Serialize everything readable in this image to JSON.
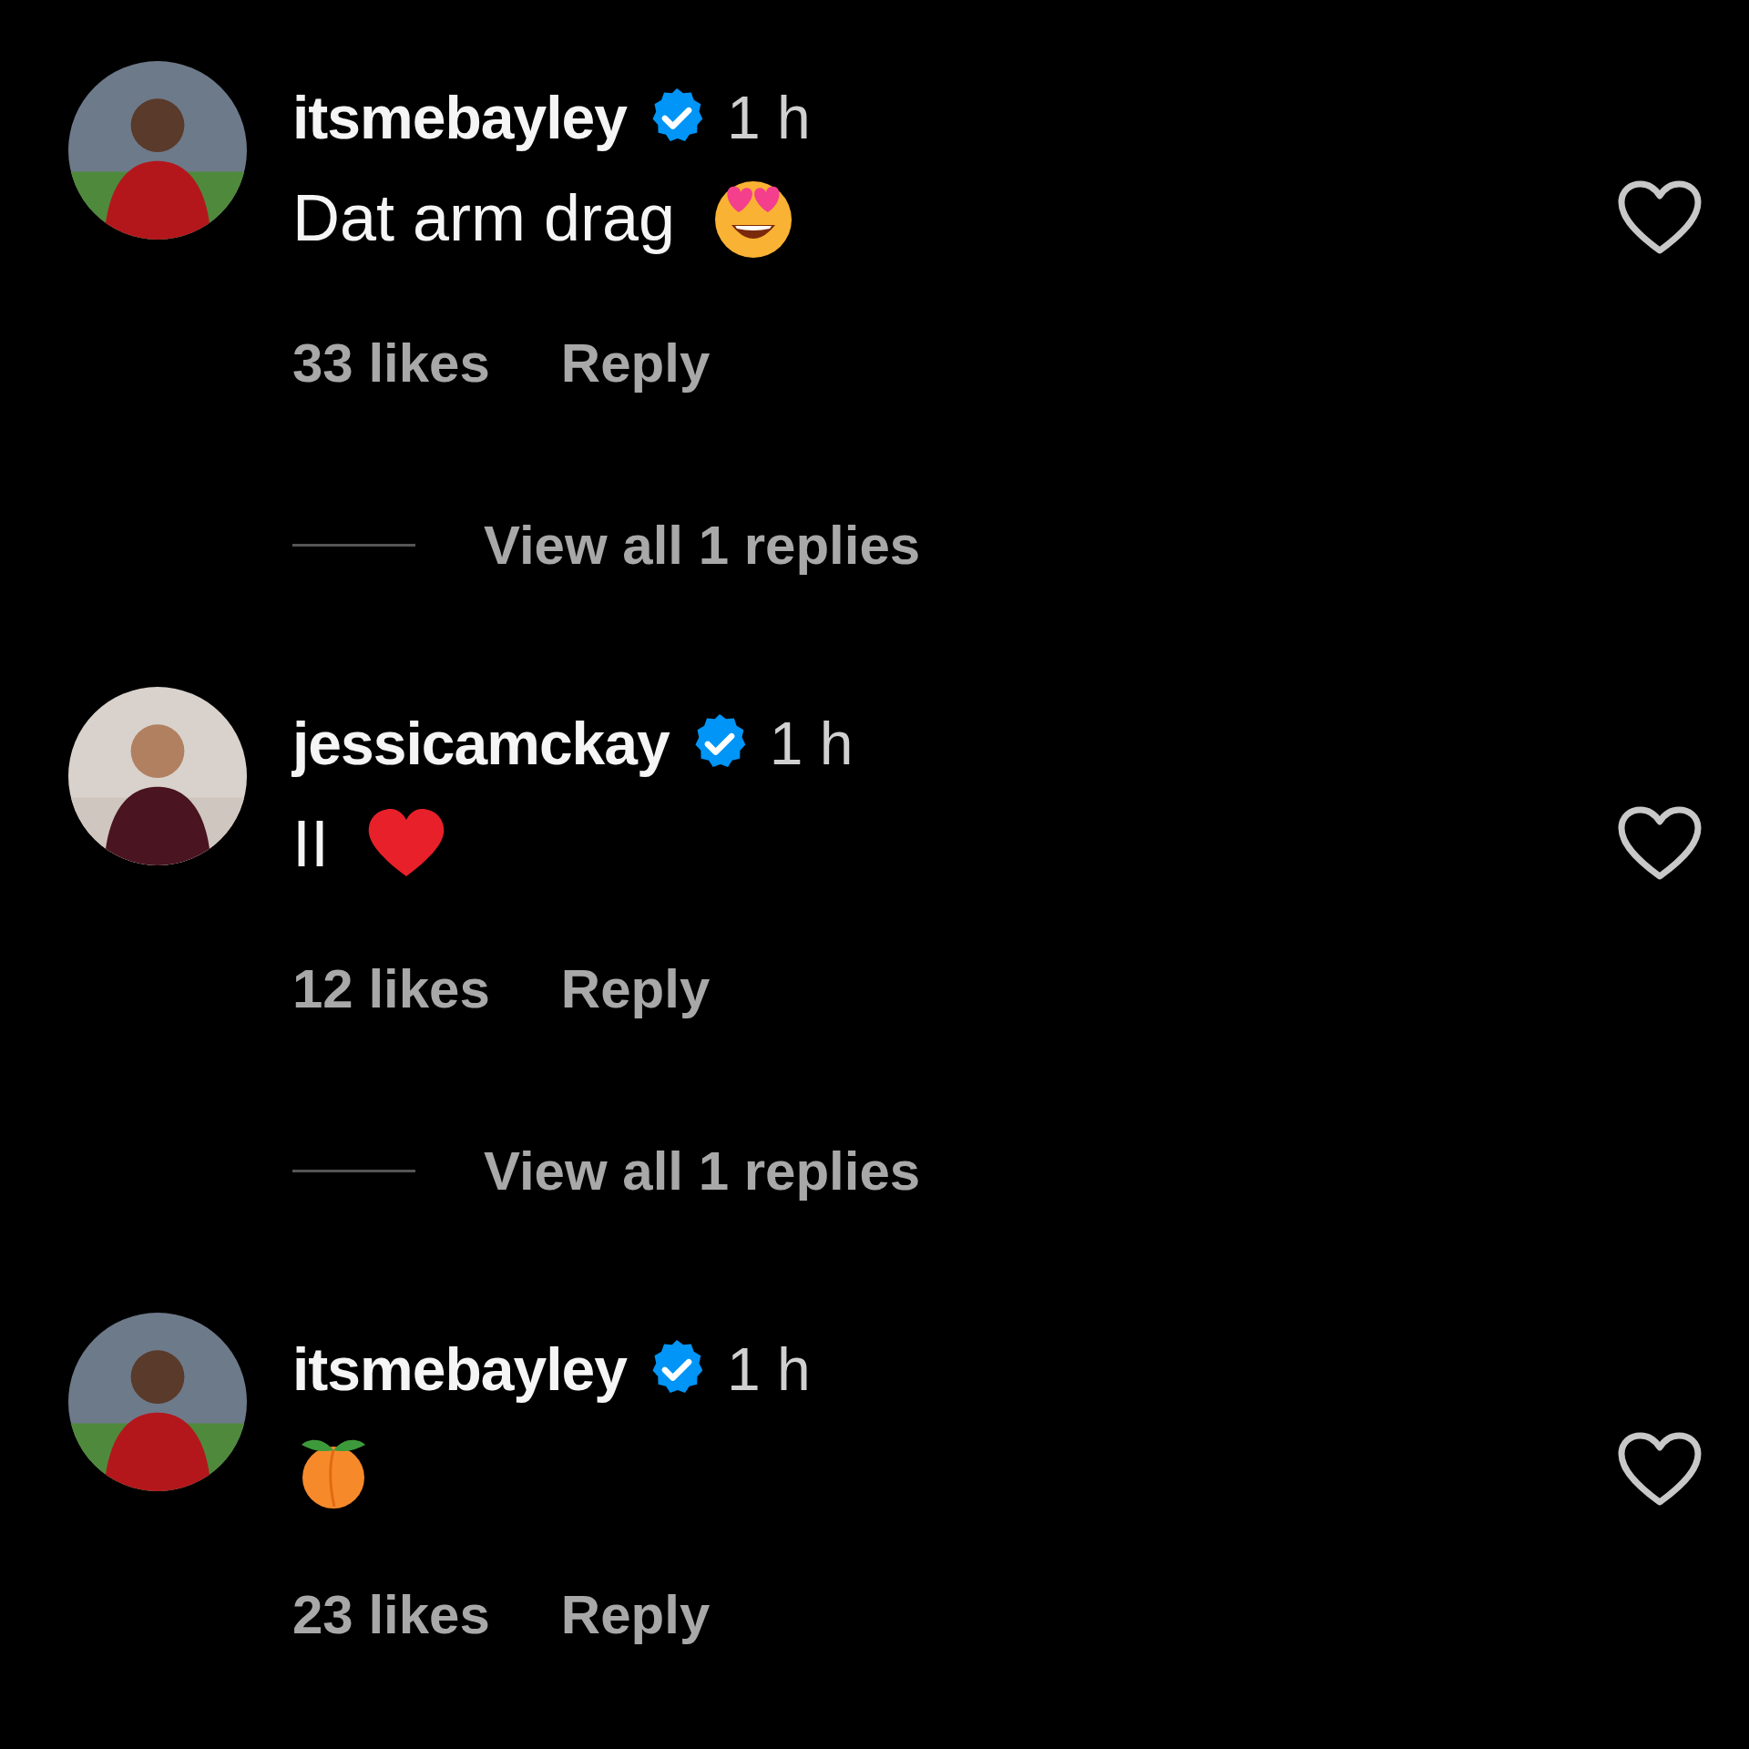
{
  "comments": [
    {
      "username": "itsmebayley",
      "verified": true,
      "time": "1 h",
      "text": "Dat arm drag",
      "emoji": {
        "kind": "heart-eyes"
      },
      "likes": "33 likes",
      "reply": "Reply",
      "liked": false,
      "view_replies": "View all 1 replies"
    },
    {
      "username": "jessicamckay",
      "verified": true,
      "time": "1 h",
      "text": "II",
      "emoji": {
        "kind": "red-heart"
      },
      "likes": "12 likes",
      "reply": "Reply",
      "liked": false,
      "view_replies": "View all 1 replies"
    },
    {
      "username": "itsmebayley",
      "verified": true,
      "time": "1 h",
      "emoji": {
        "kind": "peach"
      },
      "likes": "23 likes",
      "reply": "Reply",
      "liked": false
    }
  ]
}
